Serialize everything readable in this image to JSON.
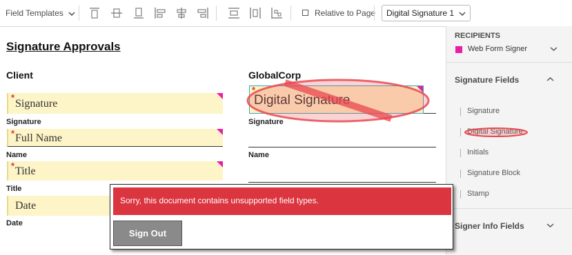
{
  "toolbar": {
    "field_templates_label": "Field Templates",
    "relative_label": "Relative to Page",
    "selected_field": "Digital Signature 1"
  },
  "document": {
    "title": "Signature Approvals",
    "client_header": "Client",
    "corp_header": "GlobalCorp",
    "client_fields": [
      {
        "placeholder": "Signature",
        "label": "Signature",
        "required": true
      },
      {
        "placeholder": "Full Name",
        "label": "Name",
        "required": true
      },
      {
        "placeholder": "Title",
        "label": "Title",
        "required": true
      },
      {
        "placeholder": "Date",
        "label": "Date",
        "required": false
      }
    ],
    "corp_fields": {
      "digital_signature_text": "Digital Signature",
      "signature_label": "Signature",
      "name_label": "Name"
    },
    "required_marker": "*"
  },
  "panel": {
    "recipients_header": "RECIPIENTS",
    "recipient_name": "Web Form Signer",
    "recipient_color": "#e81ea4",
    "signature_fields_header": "Signature Fields",
    "signature_field_items": [
      "Signature",
      "Digital Signature",
      "Initials",
      "Signature Block",
      "Stamp"
    ],
    "signer_info_header": "Signer Info Fields"
  },
  "modal": {
    "error_text": "Sorry, this document contains unsupported field types.",
    "error_color": "#db3540",
    "signout_label": "Sign Out"
  },
  "colors": {
    "field_bg": "#fdf4c7",
    "required": "#e03a1e",
    "highlight_circle": "#e8474f"
  },
  "icons": [
    "chevron-down-icon",
    "align-top-icon",
    "align-middle-icon",
    "align-bottom-icon",
    "align-left-icon",
    "align-center-icon",
    "align-right-icon",
    "distribute-vertical-icon",
    "distribute-horizontal-icon",
    "size-icon",
    "checkbox-icon",
    "chevron-up-icon"
  ]
}
